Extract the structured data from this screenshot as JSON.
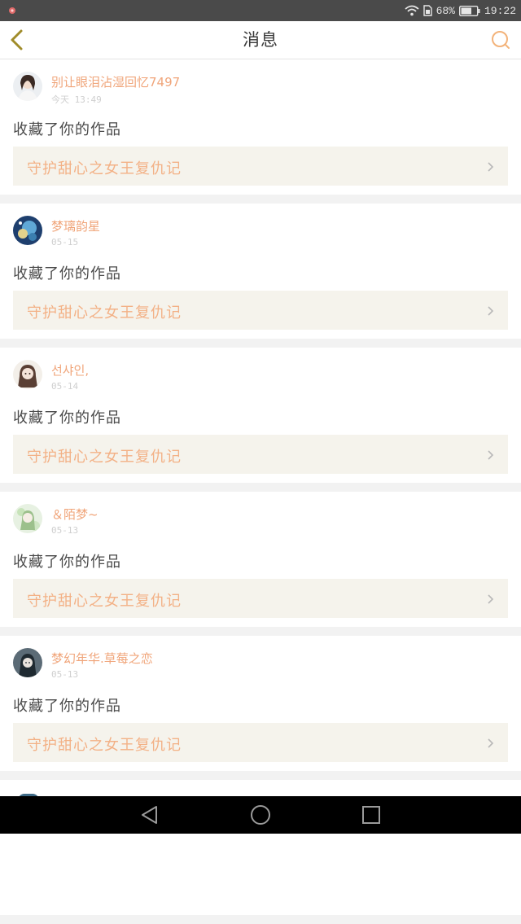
{
  "status_bar": {
    "battery_percent": "68%",
    "time": "19:22",
    "icons": [
      "notification-app-icon",
      "wifi-icon",
      "sim-icon",
      "battery-icon"
    ]
  },
  "header": {
    "title": "消息",
    "back_icon": "back-chevron-icon",
    "search_icon": "search-icon"
  },
  "colors": {
    "accent": "#f0a57a",
    "work_box_bg": "#f5f3ec",
    "work_title": "#f3b186",
    "page_bg": "#f2f2f2"
  },
  "feed": [
    {
      "username": "别让眼泪沾湿回忆7497",
      "time": "今天 13:49",
      "action": "收藏了你的作品",
      "work_title": "守护甜心之女王复仇记"
    },
    {
      "username": "梦璃韵星",
      "time": "05-15",
      "action": "收藏了你的作品",
      "work_title": "守护甜心之女王复仇记"
    },
    {
      "username": "선샤인,",
      "time": "05-14",
      "action": "收藏了你的作品",
      "work_title": "守护甜心之女王复仇记"
    },
    {
      "username": "＆陌梦~",
      "time": "05-13",
      "action": "收藏了你的作品",
      "work_title": "守护甜心之女王复仇记"
    },
    {
      "username": "梦幻年华.草莓之恋",
      "time": "05-13",
      "action": "收藏了你的作品",
      "work_title": "守护甜心之女王复仇记"
    }
  ],
  "nav_bar": {
    "icons": [
      "back-triangle-icon",
      "home-circle-icon",
      "recents-square-icon"
    ]
  }
}
